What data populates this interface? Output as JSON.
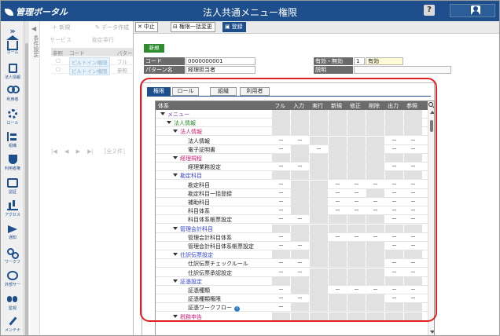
{
  "app": {
    "logo_text": "管理ポータル",
    "title": "法人共通メニュー権限",
    "help_label": "?"
  },
  "nav": {
    "expand_label": "»",
    "items": [
      {
        "label": "ホーム",
        "icon": "home-icon"
      },
      {
        "label": "法人情報",
        "icon": "document-icon"
      },
      {
        "label": "利用者",
        "icon": "people-icon"
      },
      {
        "label": "ロール",
        "icon": "gear-icon"
      },
      {
        "label": "組織",
        "icon": "org-tree-icon"
      },
      {
        "label": "利用者権",
        "icon": "shield-icon"
      },
      {
        "label": "認証",
        "icon": "id-card-icon"
      },
      {
        "label": "アクセス",
        "icon": "bar-chart-icon"
      },
      {
        "label": "通知",
        "icon": "paper-plane-icon"
      },
      {
        "label": "ワークフ",
        "icon": "workflow-icon"
      },
      {
        "label": "外部サー",
        "icon": "external-service-icon"
      },
      {
        "label": "監視",
        "icon": "binoculars-icon"
      },
      {
        "label": "メンテナ",
        "icon": "wrench-icon"
      }
    ]
  },
  "conditions": {
    "arrow": "◀",
    "label": "条件設定"
  },
  "background": {
    "toolbar": {
      "new_label": "新規",
      "data_create_label": "データ作成"
    },
    "labels": {
      "service": "サービス",
      "kanjo": "勘定奉行"
    },
    "table": {
      "headers": [
        "参照",
        "コード",
        "パター"
      ],
      "rows": [
        {
          "code": "ビルトイン権限",
          "pattern": "フル"
        },
        {
          "code": "ビルトイン権限",
          "pattern": "参照"
        }
      ]
    },
    "pager": {
      "first": "|◀",
      "prev": "◀",
      "next": "▶",
      "last": "▶|",
      "count": "［全２件］"
    }
  },
  "modal": {
    "toolbar": {
      "cancel_label": "中止",
      "bulk_change_label": "権限一括変更",
      "register_label": "登録"
    },
    "badge": "新規",
    "fields": {
      "code": {
        "label": "コード",
        "value": "0000000001"
      },
      "pattern": {
        "label": "パターン名",
        "value": "経理担当者"
      },
      "validity": {
        "label": "有効・無効",
        "code": "1",
        "value": "有効"
      },
      "description": {
        "label": "説明",
        "value": ""
      }
    },
    "tabs": [
      "権限",
      "ロール",
      "組織",
      "利用者"
    ],
    "active_tab": "権限",
    "grid": {
      "headers": [
        "体系",
        "フル",
        "入力",
        "実行",
        "新規",
        "修正",
        "削除",
        "出力",
        "参照"
      ],
      "rows": [
        {
          "label": "メニュー",
          "level": 0,
          "toggle": true,
          "color": "#7a3ea8",
          "cells": [
            "",
            "",
            "",
            "",
            "",
            "",
            "",
            ""
          ]
        },
        {
          "label": "法人情報",
          "level": 1,
          "toggle": true,
          "color": "#2e8b2e",
          "cells": [
            "",
            "",
            "",
            "",
            "",
            "",
            "",
            ""
          ]
        },
        {
          "label": "法人情報",
          "level": 2,
          "toggle": true,
          "color": "#d0237a",
          "cells": [
            "",
            "",
            "",
            "",
            "",
            "",
            "",
            ""
          ]
        },
        {
          "label": "法人情報",
          "level": 3,
          "toggle": false,
          "color": "#222222",
          "cells": [
            "－",
            "－",
            "",
            "",
            "",
            "",
            "－",
            "－"
          ]
        },
        {
          "label": "電子証明書",
          "level": 3,
          "toggle": false,
          "color": "#222222",
          "cells": [
            "－",
            "",
            "－",
            "",
            "",
            "",
            "－",
            "－"
          ]
        },
        {
          "label": "経理規程",
          "level": 2,
          "toggle": true,
          "color": "#d0237a",
          "cells": [
            "",
            "",
            "",
            "",
            "",
            "",
            "",
            ""
          ]
        },
        {
          "label": "経理業務設定",
          "level": 3,
          "toggle": false,
          "color": "#222222",
          "cells": [
            "－",
            "－",
            "",
            "",
            "",
            "",
            "－",
            "－"
          ]
        },
        {
          "label": "勘定科目",
          "level": 2,
          "toggle": true,
          "color": "#2e3fd1",
          "cells": [
            "",
            "",
            "",
            "",
            "",
            "",
            "",
            ""
          ]
        },
        {
          "label": "勘定科目",
          "level": 3,
          "toggle": false,
          "color": "#222222",
          "cells": [
            "－",
            "",
            "",
            "－",
            "－",
            "－",
            "－",
            "－"
          ]
        },
        {
          "label": "勘定科目一括登録",
          "level": 3,
          "toggle": false,
          "color": "#222222",
          "cells": [
            "－",
            "",
            "",
            "－",
            "－",
            "",
            "－",
            "－"
          ]
        },
        {
          "label": "補助科目",
          "level": 3,
          "toggle": false,
          "color": "#222222",
          "cells": [
            "－",
            "",
            "",
            "－",
            "－",
            "－",
            "－",
            "－"
          ]
        },
        {
          "label": "科目体系",
          "level": 3,
          "toggle": false,
          "color": "#222222",
          "cells": [
            "－",
            "",
            "",
            "－",
            "－",
            "－",
            "－",
            "－"
          ]
        },
        {
          "label": "科目体系帳票設定",
          "level": 3,
          "toggle": false,
          "color": "#222222",
          "cells": [
            "－",
            "－",
            "",
            "",
            "",
            "",
            "－",
            "－"
          ]
        },
        {
          "label": "管理会計科目",
          "level": 2,
          "toggle": true,
          "color": "#2e3fd1",
          "cells": [
            "",
            "",
            "",
            "",
            "",
            "",
            "",
            ""
          ]
        },
        {
          "label": "管理会計科目体系",
          "level": 3,
          "toggle": false,
          "color": "#222222",
          "cells": [
            "－",
            "",
            "",
            "－",
            "－",
            "－",
            "－",
            "－"
          ]
        },
        {
          "label": "管理会計科目体系帳票設定",
          "level": 3,
          "toggle": false,
          "color": "#222222",
          "cells": [
            "－",
            "－",
            "",
            "",
            "",
            "",
            "－",
            "－"
          ]
        },
        {
          "label": "仕訳伝票設定",
          "level": 2,
          "toggle": true,
          "color": "#2e3fd1",
          "cells": [
            "",
            "",
            "",
            "",
            "",
            "",
            "",
            ""
          ]
        },
        {
          "label": "仕訳伝票チェックルール",
          "level": 3,
          "toggle": false,
          "color": "#222222",
          "cells": [
            "－",
            "－",
            "",
            "",
            "",
            "",
            "－",
            "－"
          ]
        },
        {
          "label": "仕訳伝票承認設定",
          "level": 3,
          "toggle": false,
          "color": "#222222",
          "cells": [
            "－",
            "－",
            "",
            "",
            "",
            "",
            "－",
            "－"
          ]
        },
        {
          "label": "証憑設定",
          "level": 2,
          "toggle": true,
          "color": "#2e3fd1",
          "cells": [
            "",
            "",
            "",
            "",
            "",
            "",
            "",
            ""
          ]
        },
        {
          "label": "証憑種類",
          "level": 3,
          "toggle": false,
          "color": "#222222",
          "cells": [
            "－",
            "",
            "",
            "－",
            "－",
            "－",
            "－",
            "－"
          ]
        },
        {
          "label": "証憑種類権限",
          "level": 3,
          "toggle": false,
          "color": "#222222",
          "cells": [
            "－",
            "－",
            "",
            "",
            "",
            "",
            "－",
            "－"
          ]
        },
        {
          "label": "証憑ワークフロー",
          "level": 3,
          "toggle": false,
          "color": "#222222",
          "info": true,
          "cells": [
            "－",
            "",
            "",
            "",
            "",
            "",
            "",
            ""
          ]
        },
        {
          "label": "税務申告",
          "level": 2,
          "toggle": true,
          "color": "#d0237a",
          "cells": [
            "",
            "",
            "",
            "",
            "",
            "",
            "",
            ""
          ]
        }
      ]
    }
  },
  "colors": {
    "accent": "#1e4f8c",
    "highlight": "#e02020",
    "new_badge": "#2e8b2e"
  }
}
